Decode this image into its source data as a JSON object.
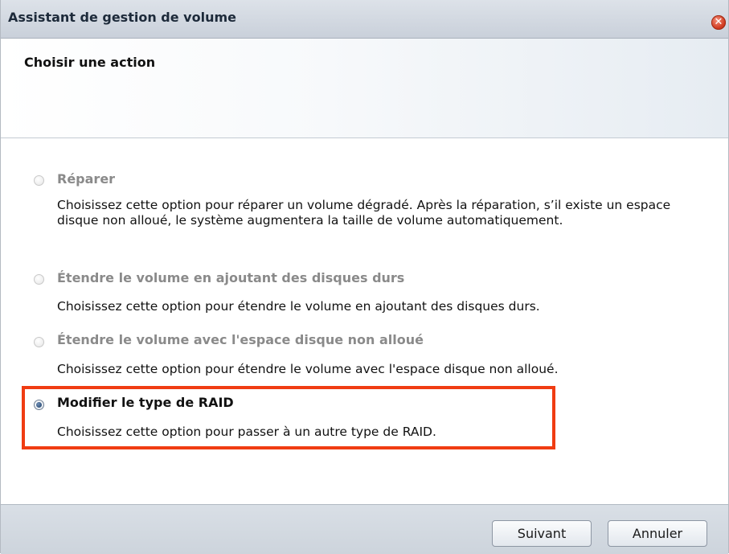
{
  "window": {
    "title": "Assistant de gestion de volume"
  },
  "header": {
    "heading": "Choisir une action"
  },
  "options": [
    {
      "label": "Réparer",
      "description": "Choisissez cette option pour réparer un volume dégradé. Après la réparation, s’il existe un espace disque non alloué, le système augmentera la taille de volume automatiquement.",
      "enabled": false,
      "checked": false
    },
    {
      "label": "Étendre le volume en ajoutant des disques durs",
      "description": "Choisissez cette option pour étendre le volume en ajoutant des disques durs.",
      "enabled": false,
      "checked": false
    },
    {
      "label": "Étendre le volume avec l'espace disque non alloué",
      "description": "Choisissez cette option pour étendre le volume avec l'espace disque non alloué.",
      "enabled": false,
      "checked": false
    },
    {
      "label": "Modifier le type de RAID",
      "description": "Choisissez cette option pour passer à un autre type de RAID.",
      "enabled": true,
      "checked": true
    }
  ],
  "footer": {
    "next_label": "Suivant",
    "cancel_label": "Annuler"
  },
  "colors": {
    "highlight_border": "#f03c12",
    "titlebar": "#d3d9e1",
    "footer": "#d3d9e1",
    "disabled_text": "#8a8a8a"
  },
  "icons": {
    "close": "close-icon"
  }
}
